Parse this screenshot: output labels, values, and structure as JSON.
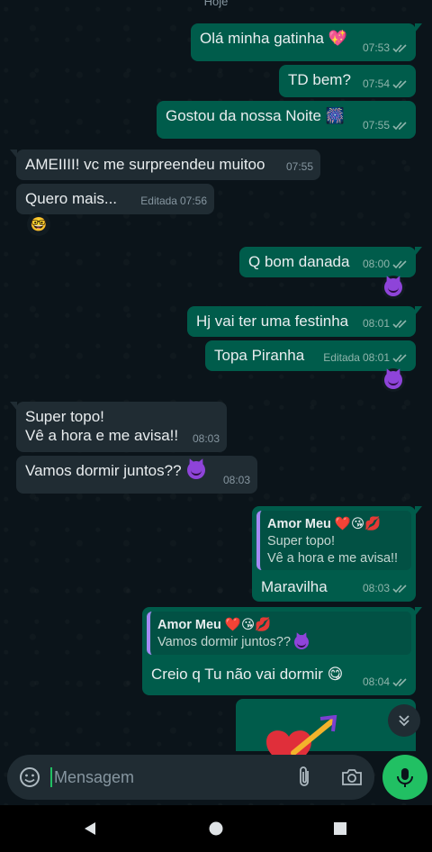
{
  "chat": {
    "date_label": "Hoje",
    "messages": [
      {
        "text": "Olá minha gatinha 💖",
        "time": "07:53"
      },
      {
        "text": "TD bem?",
        "time": "07:54"
      },
      {
        "text": "Gostou da nossa Noite 🎆",
        "time": "07:55"
      },
      {
        "text": "AMEIIII! vc me surpreendeu muitoo",
        "time": "07:55"
      },
      {
        "text": "Quero mais...",
        "edited": "Editada",
        "time": "07:56",
        "reaction": "🤓"
      },
      {
        "text": "Q bom danada",
        "time": "08:00",
        "reaction": "devil-face"
      },
      {
        "text": "Hj vai ter uma festinha",
        "time": "08:01"
      },
      {
        "text": "Topa Piranha",
        "edited": "Editada",
        "time": "08:01",
        "reaction": "devil-face"
      },
      {
        "line1": "Super topo!",
        "line2": "Vê a hora e me avisa!!",
        "time": "08:03"
      },
      {
        "text": "Vamos dormir juntos??",
        "time": "08:03"
      },
      {
        "quote_name": "Amor Meu ❤️😘💋",
        "quote_line1": "Super topo!",
        "quote_line2": "Vê a hora e me avisa!!",
        "text": "Maravilha",
        "time": "08:03"
      },
      {
        "quote_name": "Amor Meu ❤️😘💋",
        "quote_line1": "Vamos dormir juntos??",
        "text": "Creio q Tu não vai dormir 😋",
        "time": "08:04"
      }
    ]
  },
  "composer": {
    "placeholder": "Mensagem",
    "icons": [
      "sticker-icon",
      "attach-icon",
      "camera-icon",
      "mic-icon"
    ]
  },
  "nav": {
    "icons": [
      "back-icon",
      "home-icon",
      "recents-icon"
    ]
  },
  "colors": {
    "background": "#0b141a",
    "outgoing": "#005c4b",
    "incoming": "#202c33",
    "read_ticks": "#8fb5ac",
    "mic_button": "#21c063"
  }
}
